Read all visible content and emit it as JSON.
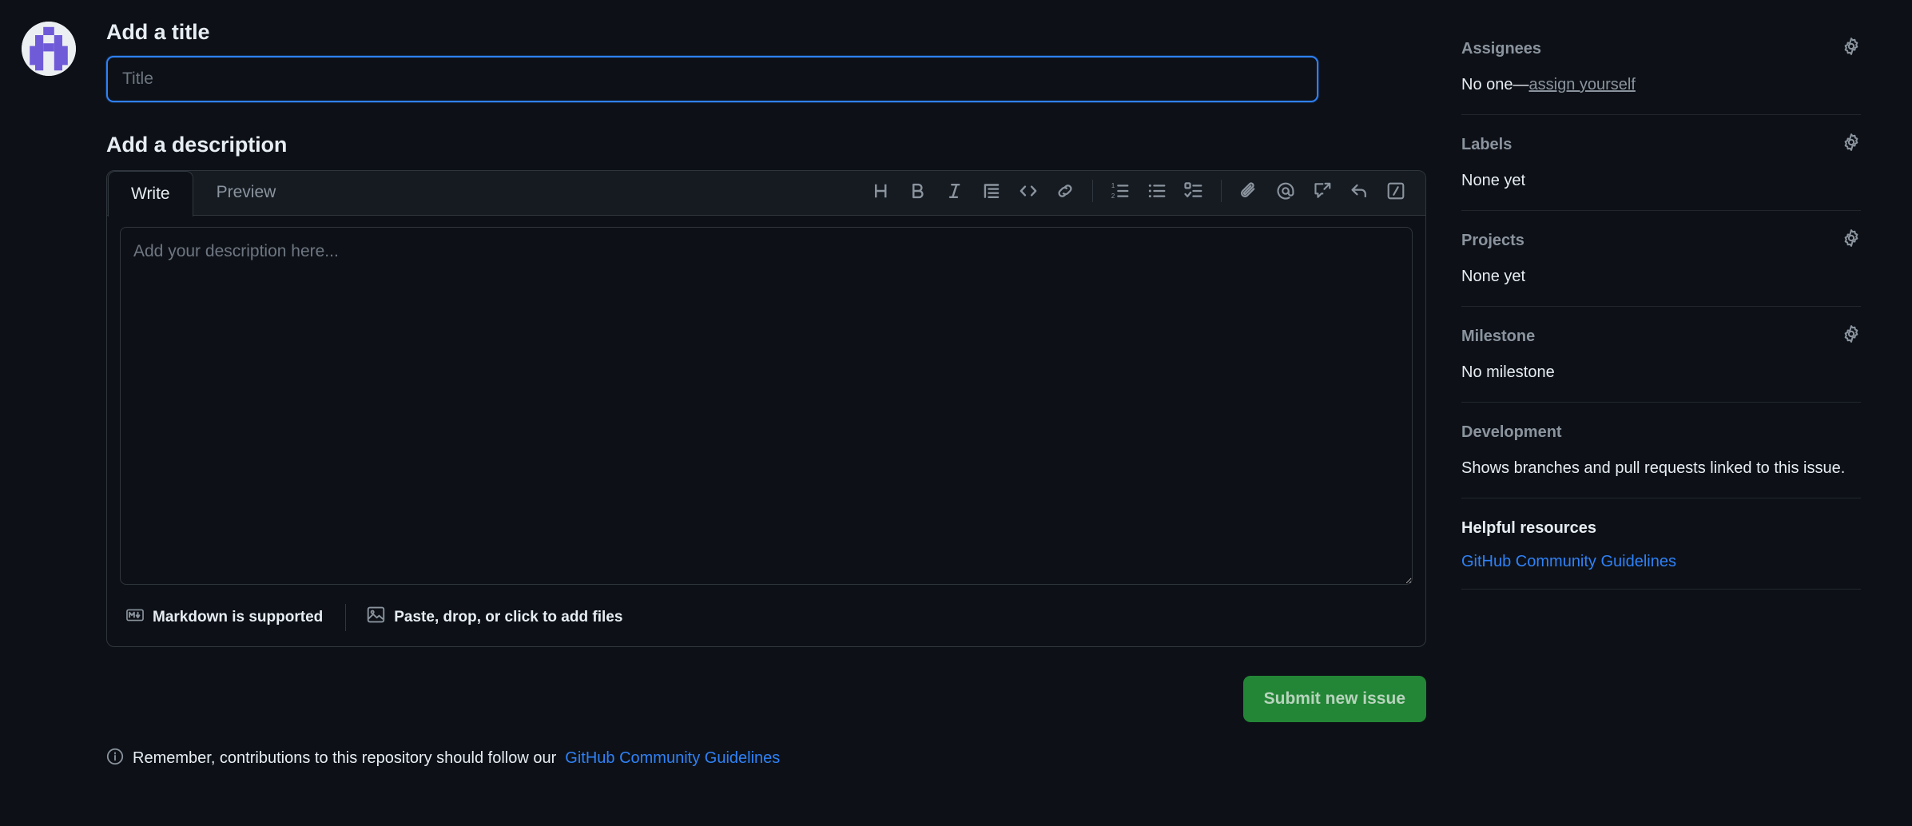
{
  "main": {
    "avatar_alt": "user-avatar",
    "title_section": {
      "heading": "Add a title",
      "placeholder": "Title",
      "value": ""
    },
    "description_section": {
      "heading": "Add a description",
      "tabs": [
        {
          "label": "Write",
          "active": true
        },
        {
          "label": "Preview",
          "active": false
        }
      ],
      "toolbar": [
        {
          "name": "heading-icon",
          "title": "Heading"
        },
        {
          "name": "bold-icon",
          "title": "Bold"
        },
        {
          "name": "italic-icon",
          "title": "Italic"
        },
        {
          "name": "quote-icon",
          "title": "Quote"
        },
        {
          "name": "code-icon",
          "title": "Code"
        },
        {
          "name": "link-icon",
          "title": "Link"
        },
        {
          "name": "ordered-list-icon",
          "title": "Numbered list"
        },
        {
          "name": "unordered-list-icon",
          "title": "Unordered list"
        },
        {
          "name": "task-list-icon",
          "title": "Task list"
        },
        {
          "name": "attachment-icon",
          "title": "Attach files"
        },
        {
          "name": "mention-icon",
          "title": "Mention"
        },
        {
          "name": "reference-icon",
          "title": "Reference"
        },
        {
          "name": "reply-icon",
          "title": "Reply"
        },
        {
          "name": "slash-command-icon",
          "title": "Slash commands"
        }
      ],
      "textarea_placeholder": "Add your description here...",
      "textarea_value": "",
      "footer": {
        "markdown_label": "Markdown is supported",
        "files_label": "Paste, drop, or click to add files"
      }
    },
    "submit_label": "Submit new issue",
    "bottom_note": {
      "text": "Remember, contributions to this repository should follow our ",
      "link": "GitHub Community Guidelines"
    }
  },
  "sidebar": {
    "sections": [
      {
        "title": "Assignees",
        "has_gear": true,
        "value_prefix": "No one—",
        "value_link": "assign yourself",
        "value": ""
      },
      {
        "title": "Labels",
        "has_gear": true,
        "value": "None yet"
      },
      {
        "title": "Projects",
        "has_gear": true,
        "value": "None yet"
      },
      {
        "title": "Milestone",
        "has_gear": true,
        "value": "No milestone"
      },
      {
        "title": "Development",
        "has_gear": false,
        "value": "Shows branches and pull requests linked to this issue."
      },
      {
        "title": "Helpful resources",
        "has_gear": false,
        "link": "GitHub Community Guidelines"
      }
    ]
  },
  "colors": {
    "background": "#0d1117",
    "surface": "#161b22",
    "border": "#30363d",
    "text": "#e6edf3",
    "muted": "#8b949e",
    "accent_blue": "#2f81f7",
    "submit_green": "#238636",
    "avatar_purple": "#6f5bd8"
  }
}
